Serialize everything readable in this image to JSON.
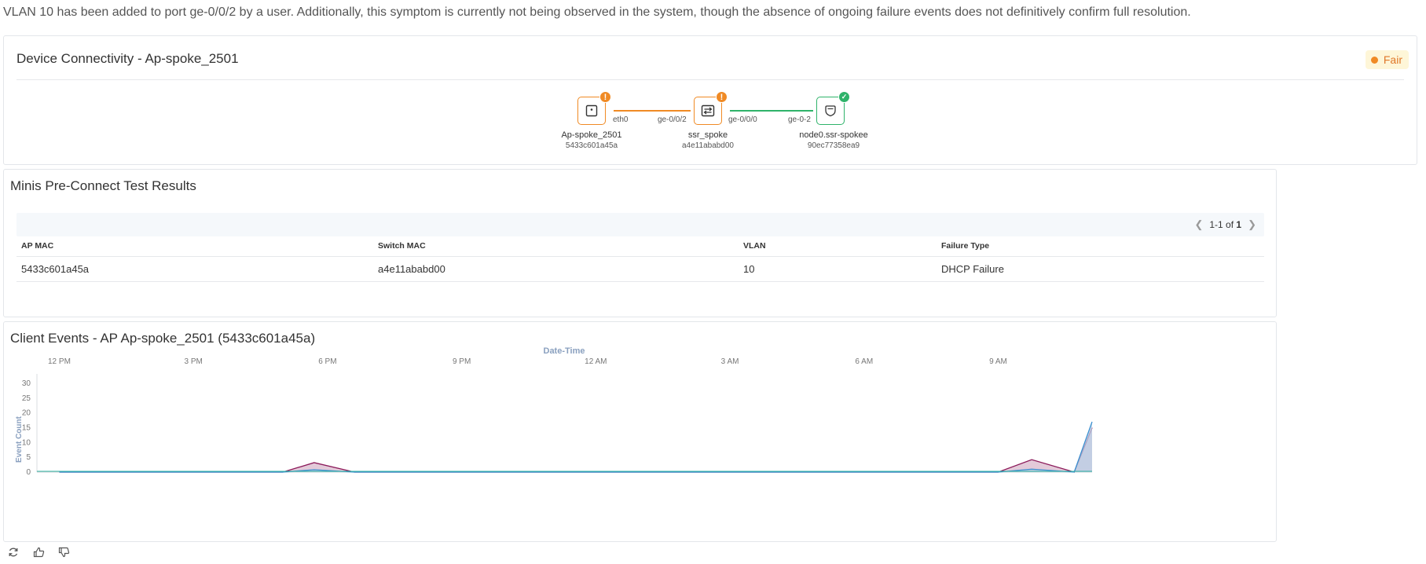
{
  "summary": "VLAN 10 has been added to port ge-0/0/2 by a user. Additionally, this symptom is currently not being observed in the system, though the absence of ongoing failure events does not definitively confirm full resolution.",
  "connectivity": {
    "title": "Device Connectivity - Ap-spoke_2501",
    "status_label": "Fair",
    "status_color": "#f08a24",
    "nodes": [
      {
        "name": "Ap-spoke_2501",
        "id": "5433c601a45a",
        "icon": "access-point-icon",
        "state": "warning"
      },
      {
        "name": "ssr_spoke",
        "id": "a4e11ababd00",
        "icon": "switch-icon",
        "state": "warning"
      },
      {
        "name": "node0.ssr-spokee",
        "id": "90ec77358ea9",
        "icon": "router-shield-icon",
        "state": "ok"
      }
    ],
    "links": [
      {
        "from_port": "eth0",
        "to_port": "ge-0/0/2",
        "color": "#f08a24"
      },
      {
        "from_port": "ge-0/0/0",
        "to_port": "ge-0-2",
        "color": "#2fb36a"
      }
    ]
  },
  "preconnect": {
    "title": "Minis Pre-Connect Test Results",
    "pager": {
      "range": "1-1",
      "of_label": "of",
      "total": "1"
    },
    "columns": [
      "AP MAC",
      "Switch MAC",
      "VLAN",
      "Failure Type"
    ],
    "rows": [
      [
        "5433c601a45a",
        "a4e11ababd00",
        "10",
        "DHCP Failure"
      ]
    ]
  },
  "events": {
    "title": "Client Events - AP Ap-spoke_2501 (5433c601a45a)",
    "chart_data": {
      "type": "area",
      "xlabel": "Date-Time",
      "ylabel": "Event Count",
      "x_ticks": [
        "12 PM",
        "3 PM",
        "6 PM",
        "9 PM",
        "12 AM",
        "3 AM",
        "6 AM",
        "9 AM"
      ],
      "yticks": [
        0,
        5,
        10,
        15,
        20,
        25,
        30
      ],
      "ylim": [
        0,
        30
      ],
      "x_position": "top",
      "series": [
        {
          "color": "#8b1a5a",
          "fill": "#d9b8cc",
          "values": [
            [
              0,
              0
            ],
            [
              5,
              0
            ],
            [
              5.7,
              3.2
            ],
            [
              6.6,
              0
            ],
            [
              21,
              0
            ],
            [
              21.75,
              4.2
            ],
            [
              22.7,
              0
            ],
            [
              23.1,
              15
            ]
          ]
        },
        {
          "color": "#3a8fd0",
          "fill": "#b8cfe6",
          "values": [
            [
              0,
              0
            ],
            [
              5,
              0
            ],
            [
              5.7,
              0.8
            ],
            [
              6.6,
              0
            ],
            [
              21,
              0
            ],
            [
              21.75,
              1
            ],
            [
              22.7,
              0
            ],
            [
              23.1,
              17
            ]
          ]
        }
      ],
      "x_range": [
        -0.5,
        23.1
      ]
    }
  },
  "footer": {
    "icons": [
      "refresh-icon",
      "thumbs-up-icon",
      "thumbs-down-icon"
    ]
  }
}
